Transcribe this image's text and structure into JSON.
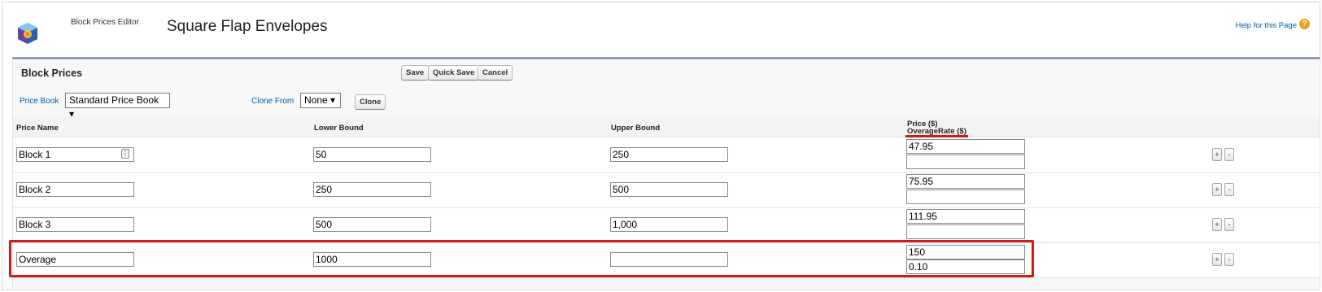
{
  "header": {
    "editor_label": "Block Prices Editor",
    "title": "Square Flap Envelopes",
    "help_link": "Help for this Page",
    "help_icon": "question-icon"
  },
  "block": {
    "title": "Block Prices",
    "buttons": {
      "save": "Save",
      "quick_save": "Quick Save",
      "cancel": "Cancel"
    }
  },
  "filters": {
    "price_book_label": "Price Book",
    "price_book_value": "Standard Price Book ▾",
    "clone_from_label": "Clone From",
    "clone_from_value": "None ▾",
    "clone_button": "Clone"
  },
  "table": {
    "columns": {
      "price_name": "Price Name",
      "lower_bound": "Lower Bound",
      "upper_bound": "Upper Bound",
      "price": "Price ($)",
      "overage_rate": "OverageRate ($)"
    },
    "rows": [
      {
        "name": "Block 1",
        "lower": "50",
        "upper": "250",
        "price": "47.95",
        "overage": ""
      },
      {
        "name": "Block 2",
        "lower": "250",
        "upper": "500",
        "price": "75.95",
        "overage": ""
      },
      {
        "name": "Block 3",
        "lower": "500",
        "upper": "1,000",
        "price": "111.95",
        "overage": ""
      },
      {
        "name": "Overage",
        "lower": "1000",
        "upper": "",
        "price": "150",
        "overage": "0.10"
      }
    ],
    "add_label": "+",
    "remove_label": "-"
  },
  "colors": {
    "accent": "#8e9dbe",
    "highlight": "#d11a1a",
    "link": "#015ba7"
  }
}
